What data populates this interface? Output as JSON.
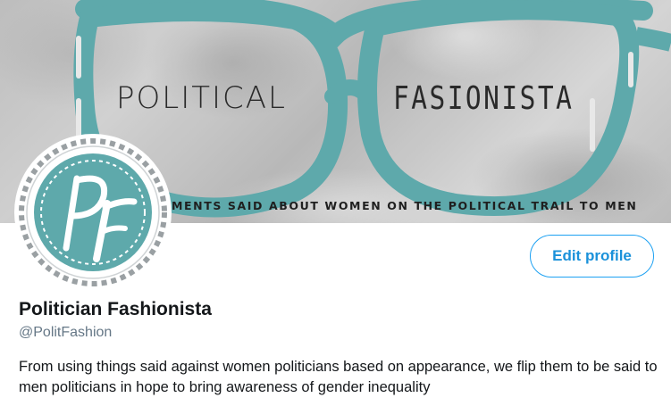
{
  "banner": {
    "word_left": "POLITICAL",
    "word_right": "FASIONISTA",
    "tagline": "MENTS SAID ABOUT WOMEN ON THE POLITICAL TRAIL TO MEN"
  },
  "avatar": {
    "monogram": "PF"
  },
  "profile": {
    "display_name": "Politician Fashionista",
    "handle": "@PolitFashion",
    "bio": "From using things said against women politicians based on appearance, we flip them to be said to men politicians in hope to bring awareness of gender inequality",
    "edit_button_label": "Edit profile"
  },
  "colors": {
    "accent": "#1da1f2",
    "brand_teal": "#5ea9ab",
    "text_primary": "#14171a",
    "text_secondary": "#657786"
  },
  "icons": {
    "avatar": "pf-monogram-logo"
  }
}
